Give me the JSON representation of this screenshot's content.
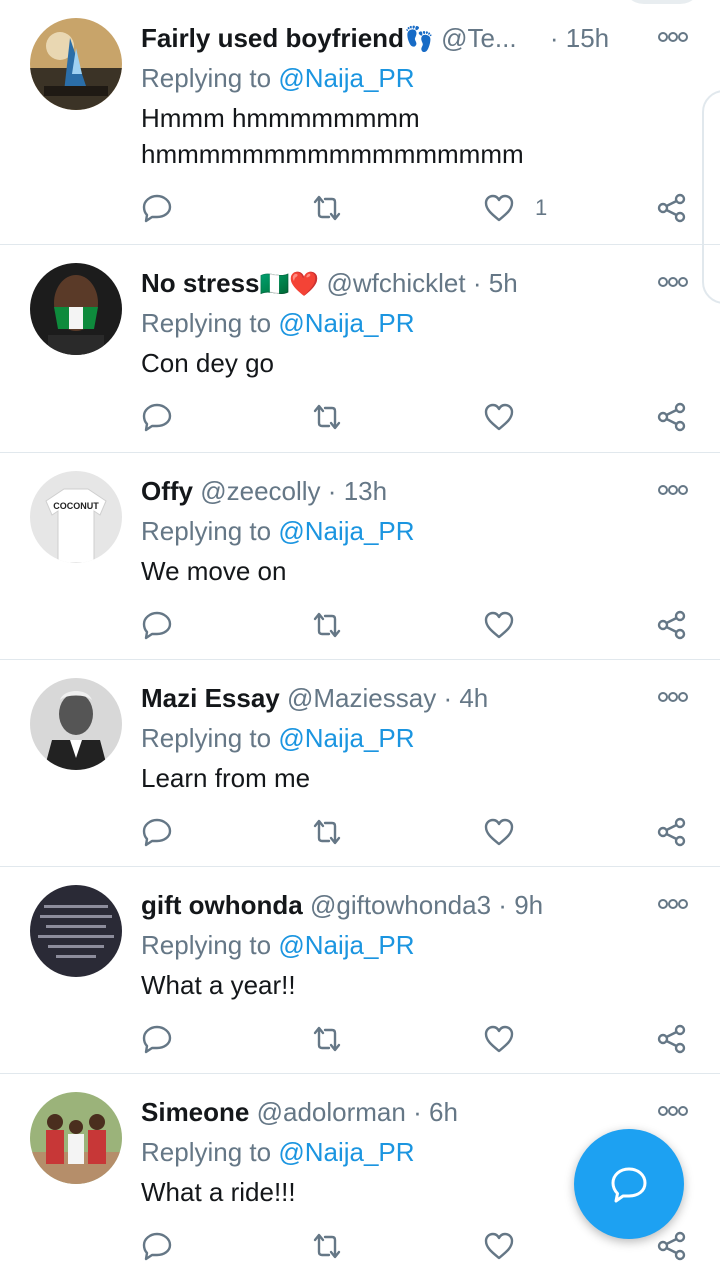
{
  "tweets": [
    {
      "name": "Fairly used boyfriend",
      "emoji": "👣",
      "handle": "@Te...",
      "time": "15h",
      "replying_prefix": "Replying to",
      "replying_to": "@Naija_PR",
      "text": "Hmmm hmmmmmmmm hmmmmmmmmmmmmmmmmm",
      "like_count": "1"
    },
    {
      "name": "No stress",
      "emoji": "🇳🇬❤️",
      "handle": "@wfchicklet",
      "time": "5h",
      "replying_prefix": "Replying to",
      "replying_to": "@Naija_PR",
      "text": "Con dey go",
      "like_count": ""
    },
    {
      "name": "Offy",
      "emoji": "",
      "handle": "@zeecolly",
      "time": "13h",
      "replying_prefix": "Replying to",
      "replying_to": "@Naija_PR",
      "text": "We move on",
      "like_count": "",
      "avatar_text": "COCONUT"
    },
    {
      "name": "Mazi Essay",
      "emoji": "",
      "handle": "@Maziessay",
      "time": "4h",
      "replying_prefix": "Replying to",
      "replying_to": "@Naija_PR",
      "text": "Learn from me",
      "like_count": ""
    },
    {
      "name": "gift owhonda",
      "emoji": "",
      "handle": "@giftowhonda3",
      "time": "9h",
      "replying_prefix": "Replying to",
      "replying_to": "@Naija_PR",
      "text": "What a year!!",
      "like_count": ""
    },
    {
      "name": "Simeone",
      "emoji": "",
      "handle": "@adolorman",
      "time": "6h",
      "replying_prefix": "Replying to",
      "replying_to": "@Naija_PR",
      "text": "What a ride!!!",
      "like_count": ""
    }
  ],
  "separator": "·",
  "icons": {
    "reply": "reply-icon",
    "retweet": "retweet-icon",
    "like": "heart-icon",
    "share": "share-icon",
    "more": "more-icon",
    "compose": "compose-reply-icon"
  },
  "colors": {
    "link": "#1b95e0",
    "muted": "#657786",
    "text": "#14171a",
    "fab": "#1da1f2",
    "divider": "#e1e8ed"
  }
}
